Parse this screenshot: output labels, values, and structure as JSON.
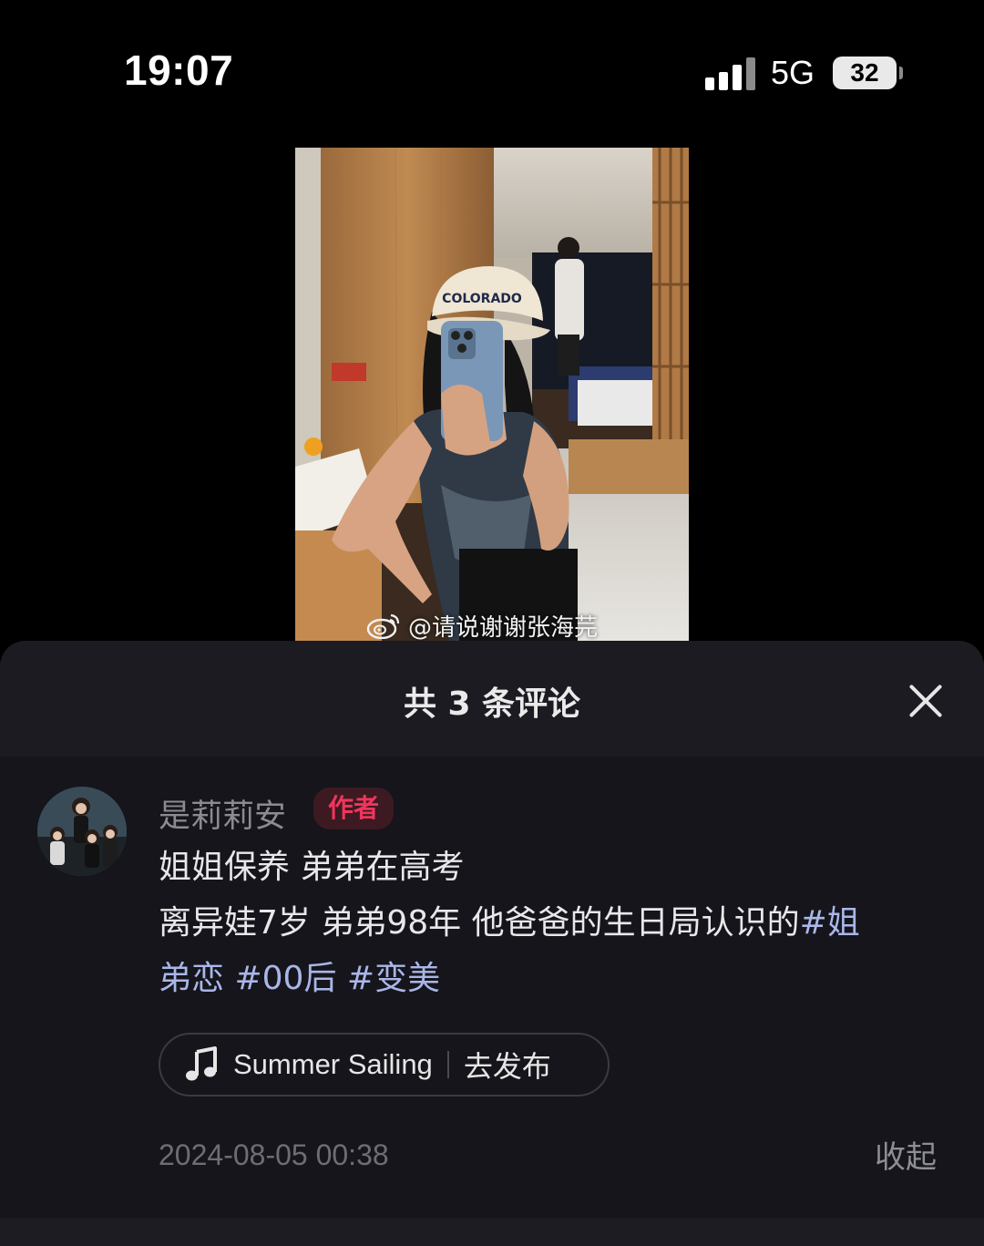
{
  "status_bar": {
    "time": "19:07",
    "network": "5G",
    "battery": "32",
    "icons": [
      "signal-icon",
      "battery-icon"
    ]
  },
  "photo": {
    "cap_text": "COLORADO",
    "watermark": "@请说谢谢张海芫",
    "watermark_icon": "weibo-icon"
  },
  "comments_panel": {
    "title": "共 3 条评论",
    "close_icon": "close-icon",
    "comment": {
      "username": "是莉莉安",
      "badge": "作者",
      "lines": [
        [
          {
            "text": "姐姐保养 弟弟在高考",
            "tag": false
          }
        ],
        [
          {
            "text": "离异娃7岁  弟弟98年 他爸爸的生日局认识的",
            "tag": false
          },
          {
            "text": "#姐",
            "tag": true
          }
        ],
        [
          {
            "text": "弟恋",
            "tag": true
          },
          {
            "text": "  ",
            "tag": false
          },
          {
            "text": "#00后",
            "tag": true
          },
          {
            "text": " ",
            "tag": false
          },
          {
            "text": "#变美",
            "tag": true
          }
        ]
      ],
      "music": {
        "icon": "music-note-icon",
        "title": "Summer Sailing",
        "action": "去发布"
      },
      "timestamp": "2024-08-05 00:38",
      "collapse": "收起"
    }
  },
  "colors": {
    "background": "#000000",
    "panel": "#15151b",
    "hashtag": "#a9b6e8",
    "author_badge": "#f0355c"
  }
}
